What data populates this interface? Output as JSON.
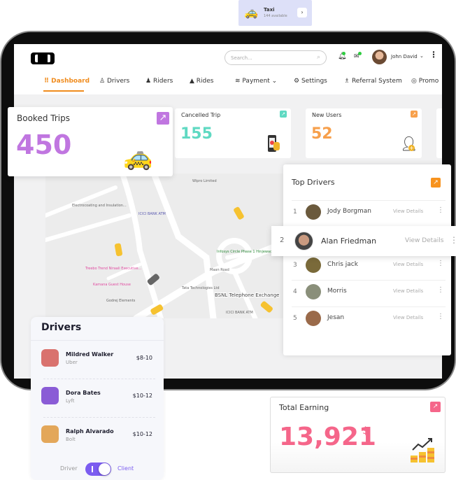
{
  "taxi_chip": {
    "title": "Taxi",
    "subtitle": "144 available",
    "icon": "taxi-icon",
    "arrow": "›"
  },
  "header": {
    "search_placeholder": "Search...",
    "user_name": "John David",
    "icons": [
      "bell-icon",
      "mail-icon",
      "avatar",
      "more-vertical-icon"
    ]
  },
  "nav": [
    {
      "label": "Dashboard",
      "icon": "grid-icon",
      "active": true
    },
    {
      "label": "Drivers",
      "icon": "driver-icon"
    },
    {
      "label": "Riders",
      "icon": "user-icon"
    },
    {
      "label": "Rides",
      "icon": "road-icon"
    },
    {
      "label": "Payment",
      "icon": "money-icon",
      "dropdown": true
    },
    {
      "label": "Settings",
      "icon": "gear-icon"
    },
    {
      "label": "Referral System",
      "icon": "referral-icon"
    },
    {
      "label": "Promo",
      "icon": "promo-icon"
    }
  ],
  "stats": {
    "booked": {
      "title": "Booked Trips",
      "value": "450",
      "color": "#c076e0"
    },
    "cancelled": {
      "title": "Cancelled Trip",
      "value": "155",
      "color": "#5fd9c2"
    },
    "new_users": {
      "title": "New Users",
      "value": "52",
      "color": "#f7a04c"
    }
  },
  "map": {
    "labels": [
      "Wipro Limited",
      "Electrocoating and Insulation...",
      "ICICI BANK ATM",
      "Infosys Circle Phase 1 Hinjewadi",
      "Maan Road",
      "Treebo Trend Niraali Executive...",
      "Kamana Guest House",
      "Godrej Elements",
      "Tata Technologies Ltd",
      "ICICI BANK ATM",
      "BSNL Telephone Exchange"
    ]
  },
  "top_drivers": {
    "title": "Top Drivers",
    "accent": "#f7931e",
    "action": "View Details",
    "rows": [
      {
        "rank": "1",
        "name": "Jody Borgman"
      },
      {
        "rank": "2",
        "name": "Alan Friedman"
      },
      {
        "rank": "3",
        "name": "Chris jack"
      },
      {
        "rank": "4",
        "name": "Morris"
      },
      {
        "rank": "5",
        "name": "Jesan"
      }
    ]
  },
  "drivers_card": {
    "title": "Drivers",
    "rows": [
      {
        "name": "Mildred Walker",
        "company": "Uber",
        "price": "$8-10",
        "color": "#d9726e"
      },
      {
        "name": "Dora Bates",
        "company": "Lyft",
        "price": "$10-12",
        "color": "#8a5cd6"
      },
      {
        "name": "Ralph Alvarado",
        "company": "Bolt",
        "price": "$10-12",
        "color": "#e3a75a"
      }
    ],
    "toggle": {
      "left": "Driver",
      "right": "Client",
      "selected": "Client",
      "color": "#7b5cf0"
    }
  },
  "earning": {
    "title": "Total Earning",
    "value": "13,921",
    "currency": "$",
    "color": "#f5668a"
  }
}
